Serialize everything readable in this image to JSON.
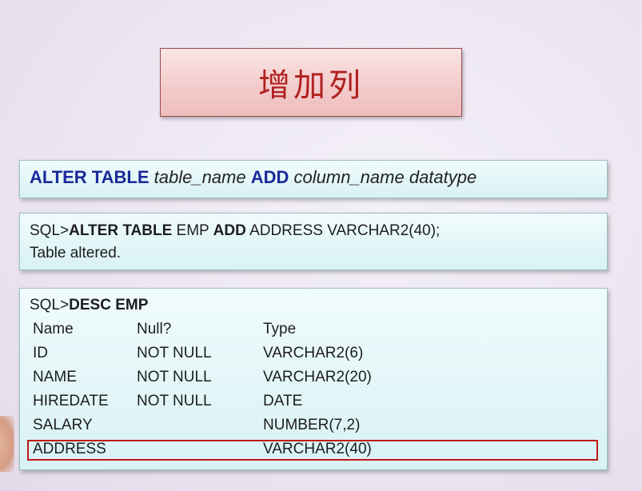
{
  "title": "增加列",
  "syntax": {
    "kw1": "ALTER TABLE",
    "p1": "table_name",
    "kw2": "ADD",
    "p2": "column_name datatype"
  },
  "statement": {
    "prompt": "SQL>",
    "kw1": "ALTER TABLE",
    "t1": "EMP",
    "kw2": "ADD",
    "t2": "ADDRESS VARCHAR2(40);",
    "result": "Table altered."
  },
  "describe": {
    "prompt": "SQL>",
    "command": "DESC EMP",
    "headers": [
      "Name",
      "Null?",
      "Type"
    ],
    "rows": [
      [
        "ID",
        "NOT NULL",
        "VARCHAR2(6)"
      ],
      [
        "NAME",
        "NOT NULL",
        "VARCHAR2(20)"
      ],
      [
        "HIREDATE",
        "NOT NULL",
        "DATE"
      ],
      [
        "SALARY",
        "",
        "NUMBER(7,2)"
      ],
      [
        "ADDRESS",
        "",
        "VARCHAR2(40)"
      ]
    ]
  },
  "colors": {
    "title": "#b02020",
    "keyword": "#1a2a9a",
    "highlight_border": "#c01818"
  }
}
